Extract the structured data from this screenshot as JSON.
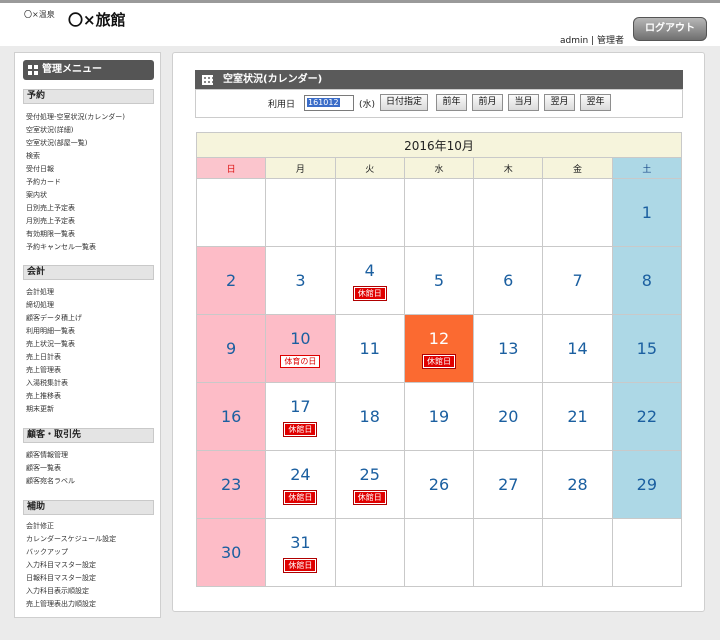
{
  "header": {
    "logo_small": "〇×温泉",
    "logo_main": "〇×旅館",
    "user_info": "admin | 管理者",
    "logout_label": "ログアウト"
  },
  "sidebar": {
    "title": "管理メニュー",
    "sections": [
      {
        "heading": "予約",
        "items": [
          "受付処理-空室状況(カレンダー)",
          "空室状況(詳細)",
          "空室状況(部屋一覧)",
          "検索",
          "受付日報",
          "予約カード",
          "案内状",
          "日別売上予定表",
          "月別売上予定表",
          "有効期限一覧表",
          "予約キャンセル一覧表"
        ]
      },
      {
        "heading": "会計",
        "items": [
          "会計処理",
          "締切処理",
          "顧客データ積上げ",
          "利用明細一覧表",
          "売上状況一覧表",
          "売上日計表",
          "売上管理表",
          "入湯税集計表",
          "売上推移表",
          "期末更新"
        ]
      },
      {
        "heading": "顧客・取引先",
        "items": [
          "顧客情報管理",
          "顧客一覧表",
          "顧客宛名ラベル"
        ]
      },
      {
        "heading": "補助",
        "items": [
          "会計修正",
          "カレンダースケジュール設定",
          "バックアップ",
          "入力科目マスター設定",
          "日報科目マスター設定",
          "入力科目表示順設定",
          "売上管理表出力順設定"
        ]
      }
    ]
  },
  "main": {
    "title": "空室状況(カレンダー)",
    "date_label": "利用日",
    "date_value": "161012",
    "date_dow": "(水)",
    "buttons": [
      "日付指定",
      "前年",
      "前月",
      "当月",
      "翌月",
      "翌年"
    ]
  },
  "calendar": {
    "title": "2016年10月",
    "weekdays": [
      "日",
      "月",
      "火",
      "水",
      "木",
      "金",
      "土"
    ],
    "weeks": [
      [
        null,
        null,
        null,
        null,
        null,
        null,
        {
          "day": "1"
        }
      ],
      [
        {
          "day": "2"
        },
        {
          "day": "3"
        },
        {
          "day": "4",
          "badge": "休館日"
        },
        {
          "day": "5"
        },
        {
          "day": "6"
        },
        {
          "day": "7"
        },
        {
          "day": "8"
        }
      ],
      [
        {
          "day": "9"
        },
        {
          "day": "10",
          "holiday": "体育の日"
        },
        {
          "day": "11"
        },
        {
          "day": "12",
          "badge": "休館日",
          "today": true
        },
        {
          "day": "13"
        },
        {
          "day": "14"
        },
        {
          "day": "15"
        }
      ],
      [
        {
          "day": "16"
        },
        {
          "day": "17",
          "badge": "休館日"
        },
        {
          "day": "18"
        },
        {
          "day": "19"
        },
        {
          "day": "20"
        },
        {
          "day": "21"
        },
        {
          "day": "22"
        }
      ],
      [
        {
          "day": "23"
        },
        {
          "day": "24",
          "badge": "休館日"
        },
        {
          "day": "25",
          "badge": "休館日"
        },
        {
          "day": "26"
        },
        {
          "day": "27"
        },
        {
          "day": "28"
        },
        {
          "day": "29"
        }
      ],
      [
        {
          "day": "30"
        },
        {
          "day": "31",
          "badge": "休館日"
        },
        null,
        null,
        null,
        null,
        null
      ]
    ],
    "colors": {
      "sunday": "#fdbcc7",
      "saturday": "#add8e6",
      "today": "#fb6a31",
      "closed_badge": "#e00000",
      "day_number": "#1b5fa0"
    }
  }
}
